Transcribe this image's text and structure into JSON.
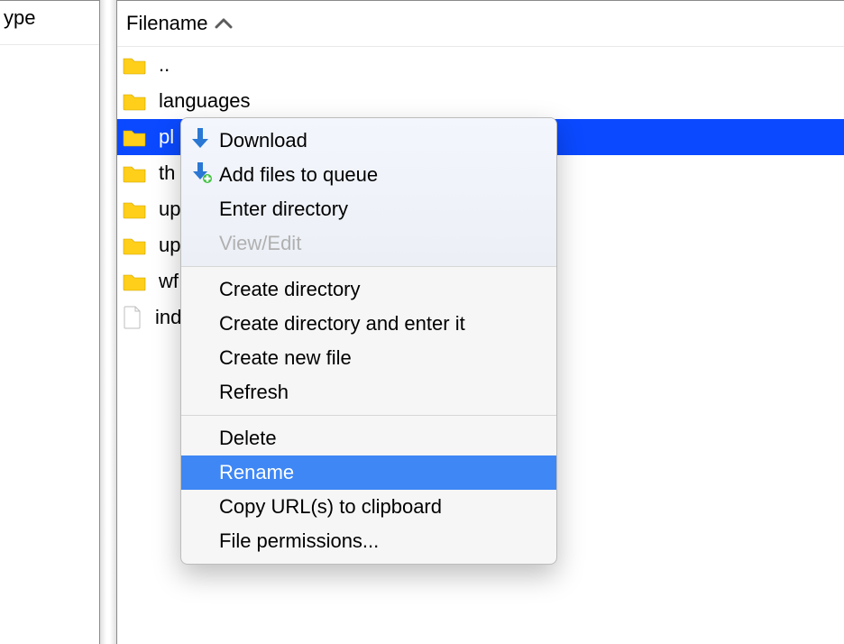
{
  "left_header_label": "ype",
  "header": {
    "filename_label": "Filename"
  },
  "rows": [
    {
      "name": "..",
      "type": "folder",
      "selected": false
    },
    {
      "name": "languages",
      "type": "folder",
      "selected": false
    },
    {
      "name": "pl",
      "type": "folder",
      "selected": true
    },
    {
      "name": "th",
      "type": "folder",
      "selected": false
    },
    {
      "name": "up",
      "type": "folder",
      "selected": false
    },
    {
      "name": "up",
      "type": "folder",
      "selected": false
    },
    {
      "name": "wf",
      "type": "folder",
      "selected": false
    },
    {
      "name": "ind",
      "type": "file",
      "selected": false
    }
  ],
  "menu": {
    "download": "Download",
    "add_to_queue": "Add files to queue",
    "enter_dir": "Enter directory",
    "view_edit": "View/Edit",
    "create_dir": "Create directory",
    "create_dir_enter": "Create directory and enter it",
    "create_file": "Create new file",
    "refresh": "Refresh",
    "delete": "Delete",
    "rename": "Rename",
    "copy_urls": "Copy URL(s) to clipboard",
    "file_perms": "File permissions..."
  }
}
